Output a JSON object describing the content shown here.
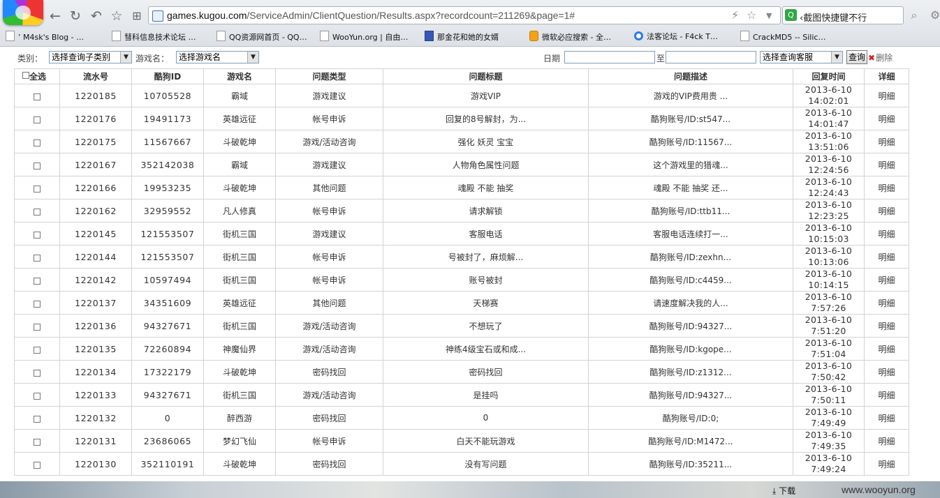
{
  "browser": {
    "url_domain": "games.kugou.com",
    "url_path": "/ServiceAdmin/ClientQuestion/Results.aspx?recordcount=211269&page=1#",
    "search_text": "‹截图快捷键不行",
    "bookmarks": [
      "’ M4sk's Blog - …",
      "彗科信息技术论坛 …",
      "QQ资源网首页 - QQ…",
      "WooYun.org | 自由…",
      "那金花和她的女婿",
      "微软必应搜索 - 全…",
      "法客论坛 - F4ck T…",
      "CrackMD5 -- Silic…"
    ]
  },
  "filters": {
    "category_label": "类别：",
    "category_select": "选择查询子类别",
    "game_label": "游戏名：",
    "game_select": "选择游戏名",
    "date_label": "日期",
    "to_label": "至",
    "service_select": "选择查询客服",
    "query_button": "查询",
    "delete_link": "删除"
  },
  "table": {
    "headers": [
      "全选",
      "流水号",
      "酷狗ID",
      "游戏名",
      "问题类型",
      "问题标题",
      "问题描述",
      "回复时间",
      "详细"
    ],
    "rows": [
      {
        "id": "1220185",
        "kid": "10705528",
        "game": "霸域",
        "type": "游戏建议",
        "title": "游戏VIP",
        "desc": "游戏的VIP费用贵 ...",
        "date": "2013-6-10",
        "time": "14:02:01",
        "detail": "明细"
      },
      {
        "id": "1220176",
        "kid": "19491173",
        "game": "英雄远征",
        "type": "帐号申诉",
        "title": "回复的8号解封，为...",
        "desc": "酷狗账号/ID:st547...",
        "date": "2013-6-10",
        "time": "14:01:47",
        "detail": "明细"
      },
      {
        "id": "1220175",
        "kid": "11567667",
        "game": "斗破乾坤",
        "type": "游戏/活动咨询",
        "title": "强化 妖灵 宝宝",
        "desc": "酷狗账号/ID:11567...",
        "date": "2013-6-10",
        "time": "13:51:06",
        "detail": "明细"
      },
      {
        "id": "1220167",
        "kid": "352142038",
        "game": "霸域",
        "type": "游戏建议",
        "title": "人物角色属性问题",
        "desc": "这个游戏里的猎魂...",
        "date": "2013-6-10",
        "time": "12:24:56",
        "detail": "明细"
      },
      {
        "id": "1220166",
        "kid": "19953235",
        "game": "斗破乾坤",
        "type": "其他问题",
        "title": "魂殿 不能 抽奖",
        "desc": "魂殿 不能 抽奖 还...",
        "date": "2013-6-10",
        "time": "12:24:43",
        "detail": "明细"
      },
      {
        "id": "1220162",
        "kid": "32959552",
        "game": "凡人修真",
        "type": "帐号申诉",
        "title": "请求解锁",
        "desc": "酷狗账号/ID:ttb11...",
        "date": "2013-6-10",
        "time": "12:23:25",
        "detail": "明细"
      },
      {
        "id": "1220145",
        "kid": "121553507",
        "game": "街机三国",
        "type": "游戏建议",
        "title": "客服电话",
        "desc": "客服电话连续打一...",
        "date": "2013-6-10",
        "time": "10:15:03",
        "detail": "明细"
      },
      {
        "id": "1220144",
        "kid": "121553507",
        "game": "街机三国",
        "type": "帐号申诉",
        "title": "号被封了，麻烦解...",
        "desc": "酷狗账号/ID:zexhn...",
        "date": "2013-6-10",
        "time": "10:13:06",
        "detail": "明细"
      },
      {
        "id": "1220142",
        "kid": "10597494",
        "game": "街机三国",
        "type": "帐号申诉",
        "title": "账号被封",
        "desc": "酷狗账号/ID:c4459...",
        "date": "2013-6-10",
        "time": "10:14:15",
        "detail": "明细"
      },
      {
        "id": "1220137",
        "kid": "34351609",
        "game": "英雄远征",
        "type": "其他问题",
        "title": "天梯赛",
        "desc": "请速度解决我的人...",
        "date": "2013-6-10",
        "time": "7:57:26",
        "detail": "明细"
      },
      {
        "id": "1220136",
        "kid": "94327671",
        "game": "街机三国",
        "type": "游戏/活动咨询",
        "title": "不想玩了",
        "desc": "酷狗账号/ID:94327...",
        "date": "2013-6-10",
        "time": "7:51:20",
        "detail": "明细"
      },
      {
        "id": "1220135",
        "kid": "72260894",
        "game": "神魔仙界",
        "type": "游戏/活动咨询",
        "title": "神练4级宝石或和成...",
        "desc": "酷狗账号/ID:kgope...",
        "date": "2013-6-10",
        "time": "7:51:04",
        "detail": "明细"
      },
      {
        "id": "1220134",
        "kid": "17322179",
        "game": "斗破乾坤",
        "type": "密码找回",
        "title": "密码找回",
        "desc": "酷狗账号/ID:z1312...",
        "date": "2013-6-10",
        "time": "7:50:42",
        "detail": "明细"
      },
      {
        "id": "1220133",
        "kid": "94327671",
        "game": "街机三国",
        "type": "游戏/活动咨询",
        "title": "是挂吗",
        "desc": "酷狗账号/ID:94327...",
        "date": "2013-6-10",
        "time": "7:50:11",
        "detail": "明细"
      },
      {
        "id": "1220132",
        "kid": "0",
        "game": "醉西游",
        "type": "密码找回",
        "title": "0",
        "desc": "酷狗账号/ID:0;",
        "date": "2013-6-10",
        "time": "7:49:49",
        "detail": "明细"
      },
      {
        "id": "1220131",
        "kid": "23686065",
        "game": "梦幻飞仙",
        "type": "帐号申诉",
        "title": "白天不能玩游戏",
        "desc": "酷狗账号/ID:M1472...",
        "date": "2013-6-10",
        "time": "7:49:35",
        "detail": "明细"
      },
      {
        "id": "1220130",
        "kid": "352110191",
        "game": "斗破乾坤",
        "type": "密码找回",
        "title": "没有写问题",
        "desc": "酷狗账号/ID:35211...",
        "date": "2013-6-10",
        "time": "7:49:24",
        "detail": "明细"
      }
    ]
  },
  "status": {
    "download_label": "下载",
    "watermark": "www.wooyun.org"
  }
}
